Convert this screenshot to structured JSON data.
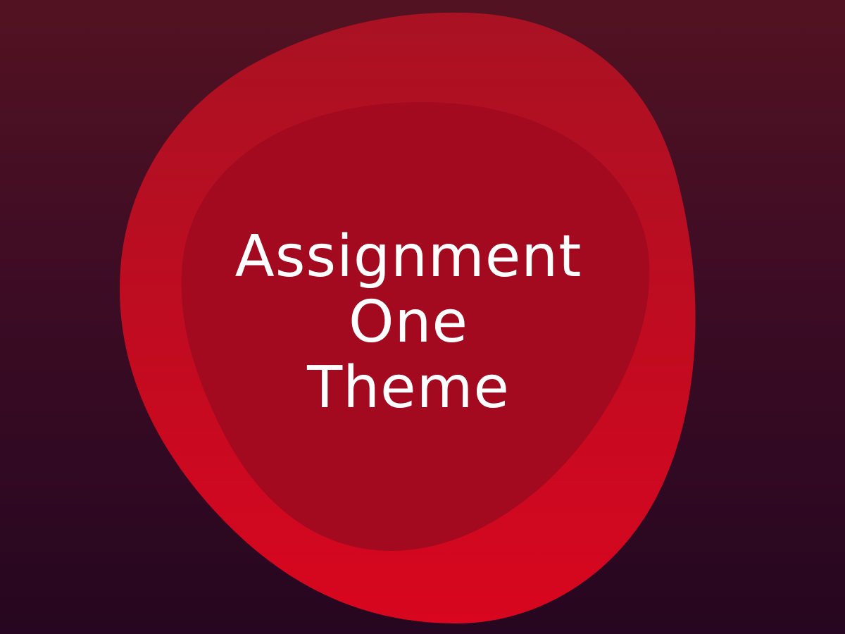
{
  "title": {
    "lines": [
      "Assignment",
      "One",
      "Theme"
    ]
  },
  "colors": {
    "background_top": "#531222",
    "background_bottom": "#260620",
    "outer_blob_top": "#a91223",
    "outer_blob_bottom": "#d8061f",
    "inner_blob": "#a30a20",
    "text": "#ffffff"
  }
}
